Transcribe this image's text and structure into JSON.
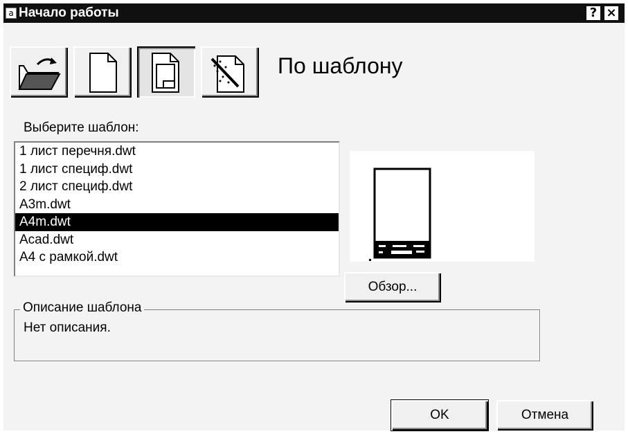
{
  "window": {
    "title": "Начало работы",
    "app_icon_glyph": "a",
    "help_glyph": "?",
    "close_glyph": "×"
  },
  "mode_buttons": [
    {
      "icon": "open-folder-icon",
      "pressed": false
    },
    {
      "icon": "blank-page-icon",
      "pressed": false
    },
    {
      "icon": "template-page-icon",
      "pressed": true
    },
    {
      "icon": "wizard-icon",
      "pressed": false
    }
  ],
  "mode_title": "По шаблону",
  "template_list": {
    "label": "Выберите шаблон:",
    "items": [
      "1 лист перечня.dwt",
      "1 лист специф.dwt",
      "2 лист специф.dwt",
      "A3m.dwt",
      "A4m.dwt",
      "Acad.dwt",
      "A4 с рамкой.dwt"
    ],
    "selected_index": 4
  },
  "browse_label": "Обзор...",
  "description": {
    "legend": "Описание шаблона",
    "text": "Нет описания."
  },
  "footer": {
    "ok_label": "OK",
    "cancel_label": "Отмена"
  },
  "colors": {
    "title_bar": "#101010",
    "dialog_bg": "#f3f3f3",
    "selection": "#000000"
  }
}
